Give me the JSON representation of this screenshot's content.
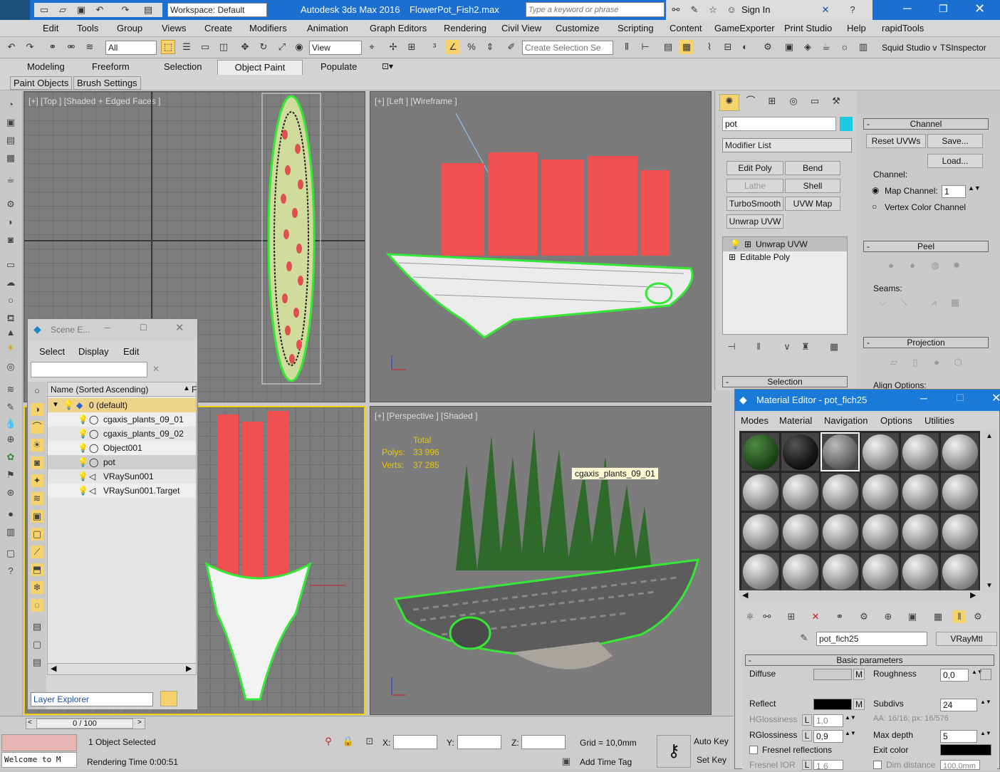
{
  "title_bar": {
    "app_logo": "MAX",
    "workspace": "Workspace: Default",
    "app_title": "Autodesk 3ds Max 2016",
    "file_name": "FlowerPot_Fish2.max",
    "search_placeholder": "Type a keyword or phrase",
    "sign_in": "Sign In"
  },
  "menu": [
    "Edit",
    "Tools",
    "Group",
    "Views",
    "Create",
    "Modifiers",
    "Animation",
    "Graph Editors",
    "Rendering",
    "Civil View",
    "Customize",
    "Scripting",
    "Content",
    "GameExporter",
    "Print Studio",
    "Help",
    "rapidTools"
  ],
  "toolbar": {
    "filter": "All",
    "ref_coord": "View",
    "selection_set_placeholder": "Create Selection Se",
    "squid": "Squid Studio v",
    "tsinspector": "TSInspector"
  },
  "ribbon_tabs": [
    "Modeling",
    "Freeform",
    "Selection",
    "Object Paint",
    "Populate"
  ],
  "ribbon_sub": [
    "Paint Objects",
    "Brush Settings"
  ],
  "viewports": {
    "top": "[+] [Top ] [Shaded + Edged Faces ]",
    "left": "[+] [Left ] [Wireframe ]",
    "persp": "[+] [Perspective ] [Shaded ]",
    "stats": {
      "total": "Total",
      "polys_label": "Polys:",
      "polys": "33 996",
      "verts_label": "Verts:",
      "verts": "37 285"
    },
    "tooltip": "cgaxis_plants_09_01"
  },
  "scene_explorer": {
    "title": "Scene E...",
    "menus": [
      "Select",
      "Display",
      "Edit"
    ],
    "column": "Name (Sorted Ascending)",
    "col2": "F",
    "items": [
      "0 (default)",
      "cgaxis_plants_09_01",
      "cgaxis_plants_09_02",
      "Object001",
      "pot",
      "VRaySun001",
      "VRaySun001.Target"
    ],
    "footer": "Layer Explorer"
  },
  "command_panel": {
    "object_name": "pot",
    "modifier_list": "Modifier List",
    "buttons": [
      "Edit Poly",
      "Bend",
      "Lathe",
      "Shell",
      "TurboSmooth",
      "UVW Map",
      "Unwrap UVW"
    ],
    "stack": [
      "Unwrap UVW",
      "Editable Poly"
    ],
    "selection": "Selection"
  },
  "uvw": {
    "channel": "Channel",
    "reset": "Reset UVWs",
    "save": "Save...",
    "load": "Load...",
    "channel_label": "Channel:",
    "map_channel": "Map Channel:",
    "map_channel_value": "1",
    "vertex_color": "Vertex Color Channel",
    "peel": "Peel",
    "seams": "Seams:",
    "projection": "Projection",
    "align": "Align Options:"
  },
  "material_editor": {
    "title": "Material Editor - pot_fich25",
    "menus": [
      "Modes",
      "Material",
      "Navigation",
      "Options",
      "Utilities"
    ],
    "material_name": "pot_fich25",
    "material_type": "VRayMtl",
    "rollout": "Basic parameters",
    "diffuse": "Diffuse",
    "roughness": "Roughness",
    "roughness_val": "0,0",
    "reflect": "Reflect",
    "subdivs": "Subdivs",
    "subdivs_val": "24",
    "hgloss": "HGlossiness",
    "hgloss_val": "1,0",
    "aa": "AA: 16/16; px: 16/576",
    "rgloss": "RGlossiness",
    "rgloss_val": "0,9",
    "maxdepth": "Max depth",
    "maxdepth_val": "5",
    "fresnel": "Fresnel reflections",
    "exit_color": "Exit color",
    "fresnel_ior": "Fresnel IOR",
    "fresnel_ior_val": "1,6",
    "dim_distance": "Dim distance",
    "dim_val": "100,0mm",
    "m": "M",
    "l": "L"
  },
  "status": {
    "timeline": "0 / 100",
    "selected": "1 Object Selected",
    "rendering": "Rendering Time 0:00:51",
    "welcome": "Welcome to M",
    "x": "X:",
    "y": "Y:",
    "z": "Z:",
    "grid": "Grid = 10,0mm",
    "auto_key": "Auto Key",
    "set_key": "Set Key",
    "add_time_tag": "Add Time Tag"
  }
}
